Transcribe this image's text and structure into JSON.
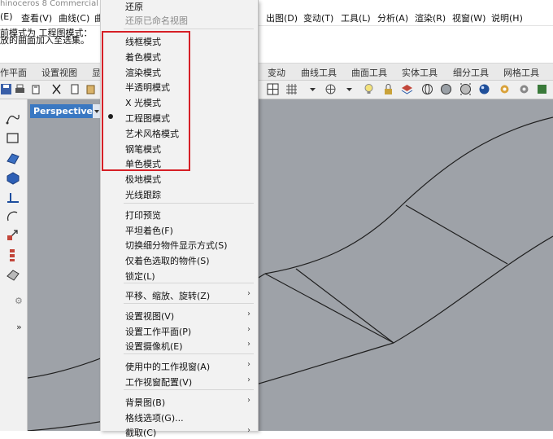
{
  "window": {
    "title": "hinoceros 8 Commercial"
  },
  "menubar": {
    "left_items": [
      "(E)",
      "查看(V)",
      "曲线(C)",
      "曲"
    ],
    "right_items": [
      "出图(D)",
      "变动(T)",
      "工具(L)",
      "分析(A)",
      "渲染(R)",
      "视窗(W)",
      "说明(H)"
    ]
  },
  "command_area": {
    "line1": "前模式为 工程图模式：",
    "line2": "放的曲面加入至选集。"
  },
  "tabs": {
    "left": [
      "作平面",
      "设置视图",
      "显"
    ],
    "right": [
      "变动",
      "曲线工具",
      "曲面工具",
      "实体工具",
      "细分工具",
      "网格工具"
    ]
  },
  "viewport": {
    "name": "Perspective"
  },
  "context_menu": {
    "top_items": [
      {
        "label": "还原",
        "disabled": false
      },
      {
        "label": "还原已命名视图",
        "disabled": true
      }
    ],
    "display_modes": [
      {
        "label": "线框模式",
        "checked": false
      },
      {
        "label": "着色模式",
        "checked": false
      },
      {
        "label": "渲染模式",
        "checked": false
      },
      {
        "label": "半透明模式",
        "checked": false
      },
      {
        "label": "X 光模式",
        "checked": false
      },
      {
        "label": "工程图模式",
        "checked": true
      },
      {
        "label": "艺术风格模式",
        "checked": false
      },
      {
        "label": "钢笔模式",
        "checked": false
      },
      {
        "label": "单色模式",
        "checked": false
      },
      {
        "label": "极地模式",
        "checked": false
      },
      {
        "label": "光线跟踪",
        "checked": false
      }
    ],
    "group2": [
      {
        "label": "打印预览"
      },
      {
        "label": "平坦着色(F)"
      },
      {
        "label": "切换细分物件显示方式(S)"
      },
      {
        "label": "仅着色选取的物件(S)"
      },
      {
        "label": "锁定(L)"
      }
    ],
    "group3": [
      {
        "label": "平移、缩放、旋转(Z)",
        "submenu": true
      }
    ],
    "group4": [
      {
        "label": "设置视图(V)",
        "submenu": true
      },
      {
        "label": "设置工作平面(P)",
        "submenu": true
      },
      {
        "label": "设置摄像机(E)",
        "submenu": true
      }
    ],
    "group5": [
      {
        "label": "使用中的工作视窗(A)",
        "submenu": true
      },
      {
        "label": "工作视窗配置(V)",
        "submenu": true
      }
    ],
    "group6": [
      {
        "label": "背景图(B)",
        "submenu": true
      },
      {
        "label": "格线选项(G)...",
        "submenu": false
      },
      {
        "label": "截取(C)",
        "submenu": true
      }
    ]
  },
  "colors": {
    "highlight_box": "#d61f26",
    "viewport_bg": "#9ea2a8",
    "viewport_tab": "#3a78c2"
  },
  "icons": {
    "submenu_arrow": "›",
    "expand_more": "»",
    "settings": "⚙"
  }
}
